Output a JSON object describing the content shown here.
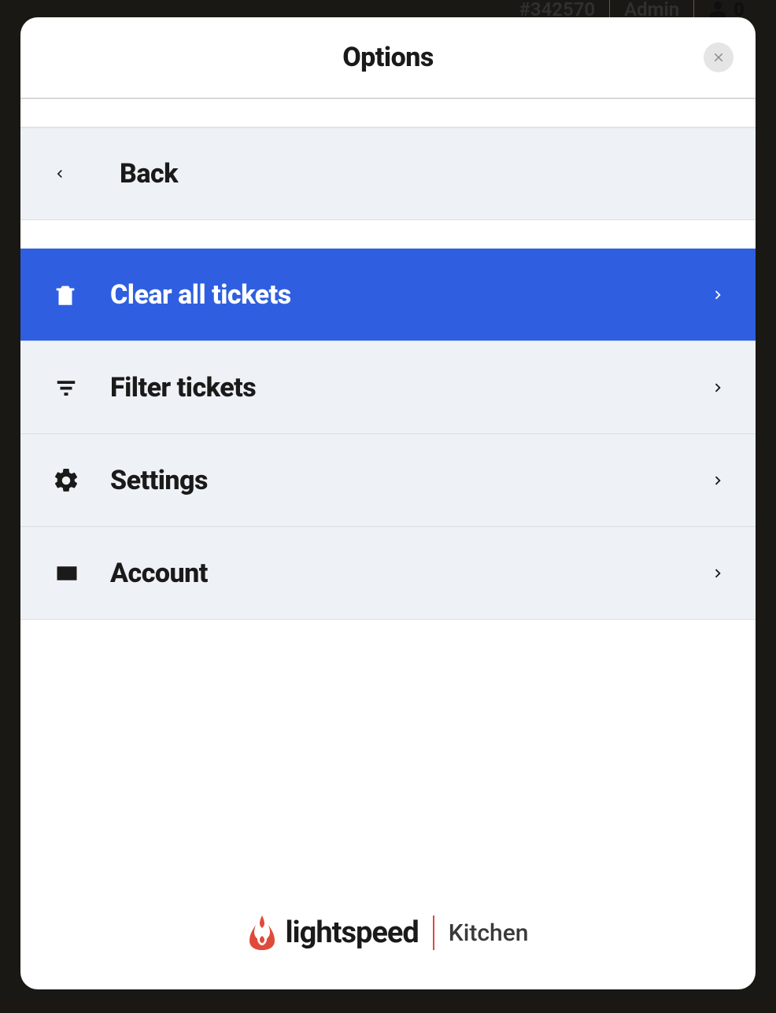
{
  "topbar": {
    "ticket_id": "#342570",
    "role": "Admin",
    "user_count": "0"
  },
  "modal": {
    "title": "Options",
    "back_label": "Back",
    "items": [
      {
        "label": "Clear all tickets"
      },
      {
        "label": "Filter tickets"
      },
      {
        "label": "Settings"
      },
      {
        "label": "Account"
      }
    ]
  },
  "brand": {
    "name": "lightspeed",
    "product": "Kitchen"
  },
  "colors": {
    "active": "#2f5fe0",
    "row_bg": "#eef1f6",
    "brand_accent": "#e04a3a"
  }
}
